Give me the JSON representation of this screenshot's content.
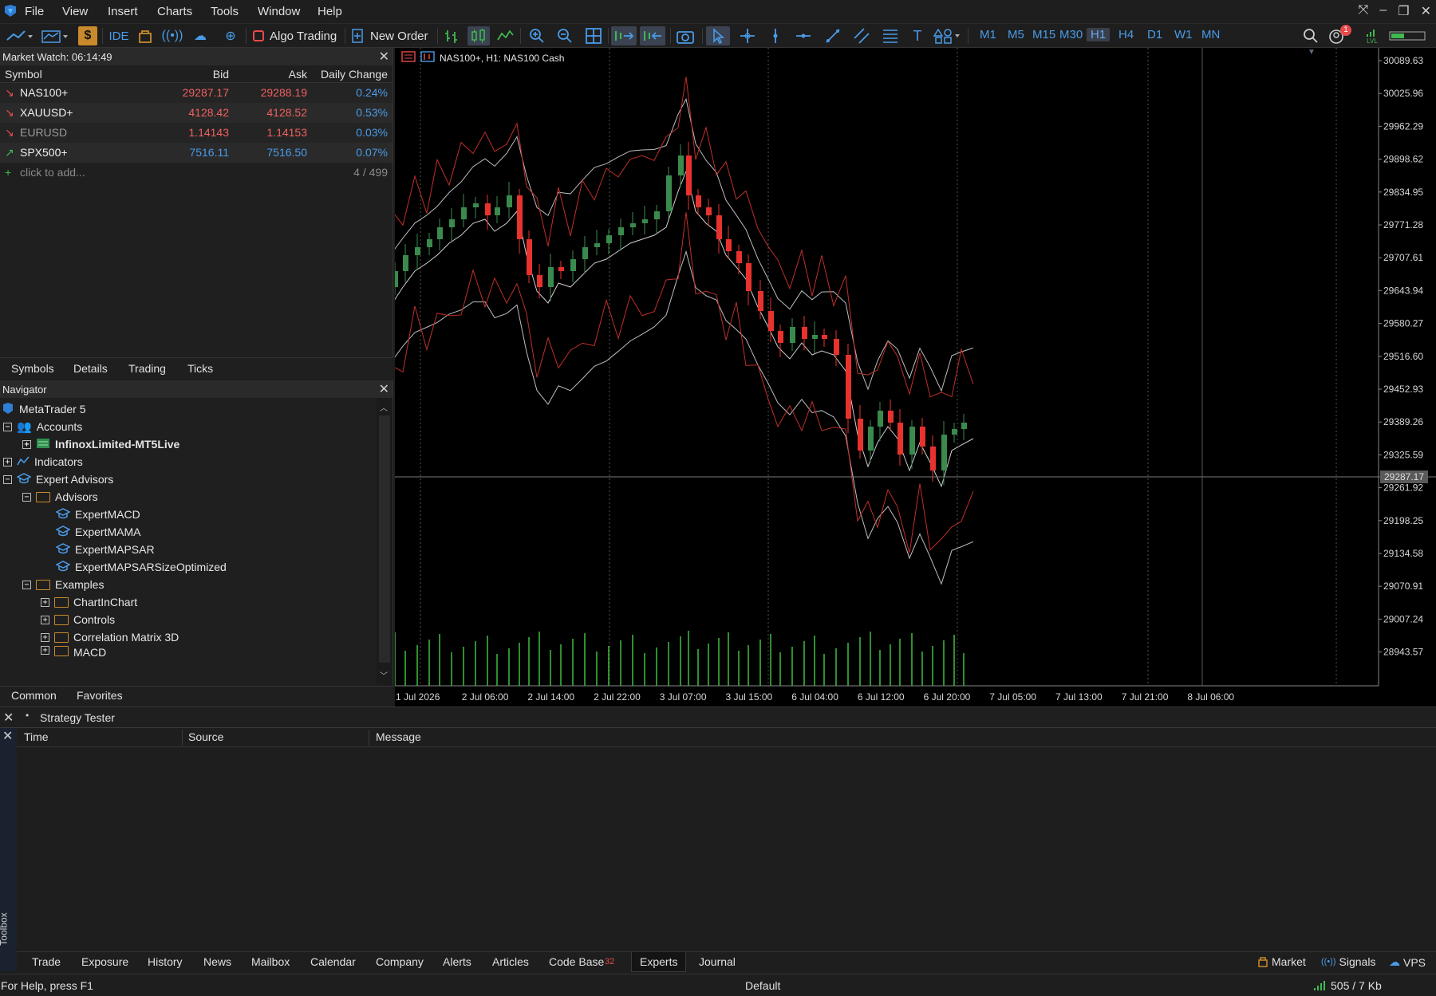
{
  "menu": [
    "File",
    "View",
    "Insert",
    "Charts",
    "Tools",
    "Window",
    "Help"
  ],
  "toolbar": {
    "ide_label": "IDE",
    "algo_label": "Algo Trading",
    "new_order_label": "New Order",
    "timeframes": [
      "M1",
      "M5",
      "M15",
      "M30",
      "H1",
      "H4",
      "D1",
      "W1",
      "MN"
    ],
    "selected_timeframe": "H1",
    "notification_count": "1",
    "lvl_label": "LVL"
  },
  "market_watch": {
    "title": "Market Watch: 06:14:49",
    "columns": [
      "Symbol",
      "Bid",
      "Ask",
      "Daily Change"
    ],
    "rows": [
      {
        "symbol": "NAS100+",
        "bid": "29287.17",
        "ask": "29288.19",
        "change": "0.24%",
        "dir": "down"
      },
      {
        "symbol": "XAUUSD+",
        "bid": "4128.42",
        "ask": "4128.52",
        "change": "0.53%",
        "dir": "down"
      },
      {
        "symbol": "EURUSD",
        "bid": "1.14143",
        "ask": "1.14153",
        "change": "0.03%",
        "dir": "down"
      },
      {
        "symbol": "SPX500+",
        "bid": "7516.11",
        "ask": "7516.50",
        "change": "0.07%",
        "dir": "up"
      }
    ],
    "add_label": "click to add...",
    "count": "4 / 499",
    "tabs": [
      "Symbols",
      "Details",
      "Trading",
      "Ticks"
    ]
  },
  "navigator": {
    "title": "Navigator",
    "root": "MetaTrader 5",
    "accounts": "Accounts",
    "account_name": "InfinoxLimited-MT5Live",
    "indicators": "Indicators",
    "experts": "Expert Advisors",
    "advisors": "Advisors",
    "advisor_items": [
      "ExpertMACD",
      "ExpertMAMA",
      "ExpertMAPSAR",
      "ExpertMAPSARSizeOptimized"
    ],
    "examples": "Examples",
    "example_items": [
      "ChartInChart",
      "Controls",
      "Correlation Matrix 3D",
      "MACD"
    ],
    "tabs": [
      "Common",
      "Favorites"
    ]
  },
  "chart": {
    "title": "NAS100+, H1:  NAS100 Cash",
    "price_labels": [
      "30089.63",
      "30025.96",
      "29962.29",
      "29898.62",
      "29834.95",
      "29771.28",
      "29707.61",
      "29643.94",
      "29580.27",
      "29516.60",
      "29452.93",
      "29389.26",
      "29325.59",
      "29261.92",
      "29198.25",
      "29134.58",
      "29070.91",
      "29007.24",
      "28943.57"
    ],
    "current_price": "29287.17",
    "time_labels": [
      "1 Jul 2026",
      "2 Jul 06:00",
      "2 Jul 14:00",
      "2 Jul 22:00",
      "3 Jul 07:00",
      "3 Jul 15:00",
      "6 Jul 04:00",
      "6 Jul 12:00",
      "6 Jul 20:00",
      "7 Jul 05:00",
      "7 Jul 13:00",
      "7 Jul 21:00",
      "8 Jul 06:00"
    ],
    "bull_color": "#3a8a4e",
    "bear_color": "#e8322e",
    "volume_color": "#3fbf3f"
  },
  "strategy_tester": {
    "label": "Strategy Tester"
  },
  "toolbox": {
    "side_label": "Toolbox",
    "columns": [
      "Time",
      "Source",
      "Message"
    ],
    "tabs": [
      "Trade",
      "Exposure",
      "History",
      "News",
      "Mailbox",
      "Calendar",
      "Company",
      "Alerts",
      "Articles",
      "Code Base",
      "Experts",
      "Journal"
    ],
    "codebase_badge": "32",
    "selected_tab": "Experts",
    "right_links": [
      "Market",
      "Signals",
      "VPS"
    ]
  },
  "status": {
    "help": "For Help, press F1",
    "profile": "Default",
    "traffic": "505 / 7 Kb"
  }
}
